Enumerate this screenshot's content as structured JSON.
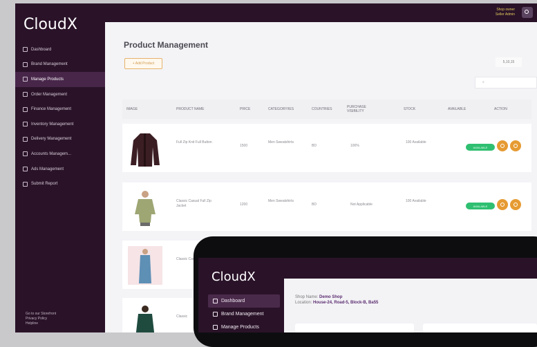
{
  "sidebar": {
    "brand": "CloudX",
    "items": [
      {
        "label": "Dashboard",
        "icon": "dashboard-icon"
      },
      {
        "label": "Brand Management",
        "icon": "brand-icon"
      },
      {
        "label": "Manage Products",
        "icon": "products-icon",
        "active": true
      },
      {
        "label": "Order Management",
        "icon": "order-icon"
      },
      {
        "label": "Finance Management",
        "icon": "finance-icon"
      },
      {
        "label": "Inventory Management",
        "icon": "inventory-icon"
      },
      {
        "label": "Delivery Management",
        "icon": "delivery-icon"
      },
      {
        "label": "Accounts Managem...",
        "icon": "accounts-icon"
      },
      {
        "label": "Ads Management",
        "icon": "ads-icon"
      },
      {
        "label": "Submit Report",
        "icon": "report-icon"
      }
    ],
    "footer": [
      "Go to our Storefront",
      "Privacy Policy",
      "Helpline"
    ]
  },
  "topbar": {
    "user_name": "Shop owner",
    "user_role": "Seller Admin"
  },
  "main": {
    "title": "Product Management",
    "add_button": "+ Add Product",
    "page_size": "5,10,15",
    "search_placeholder": "",
    "search_icon_glyph": "⌕",
    "columns": [
      "IMAGE",
      "PRODUCT NAME",
      "PRICE",
      "CATEGORY/IES",
      "COUNTRIES",
      "PURCHASE VISIBILITY",
      "STOCK",
      "AVAILABLE",
      "ACTION"
    ],
    "rows": [
      {
        "name": "Full Zip Knit Full Button",
        "price": "1500",
        "category": "Men Sweatshirts",
        "countries": "BD",
        "visibility": "100%",
        "stock": "100 Available",
        "status": "AVAILABLE"
      },
      {
        "name": "Classic Casual Full Zip Jacket",
        "price": "1200",
        "category": "Men Sweatshirts",
        "countries": "BD",
        "visibility": "Not Applicable",
        "stock": "100 Available",
        "status": "AVAILABLE"
      },
      {
        "name": "Classic Cami",
        "price": "",
        "category": "",
        "countries": "",
        "visibility": "",
        "stock": "",
        "status": ""
      },
      {
        "name": "Classic",
        "price": "",
        "category": "",
        "countries": "",
        "visibility": "",
        "stock": "",
        "status": ""
      }
    ]
  },
  "tablet": {
    "brand": "CloudX",
    "items": [
      {
        "label": "Dashboard",
        "icon": "dashboard-icon",
        "active": true
      },
      {
        "label": "Brand Management",
        "icon": "brand-icon"
      },
      {
        "label": "Manage Products",
        "icon": "products-icon"
      }
    ],
    "shop_name_label": "Shop Name:",
    "shop_name": "Demo Shop",
    "location_label": "Location:",
    "location": "House-24, Road-5, Block-B, Ba55"
  }
}
